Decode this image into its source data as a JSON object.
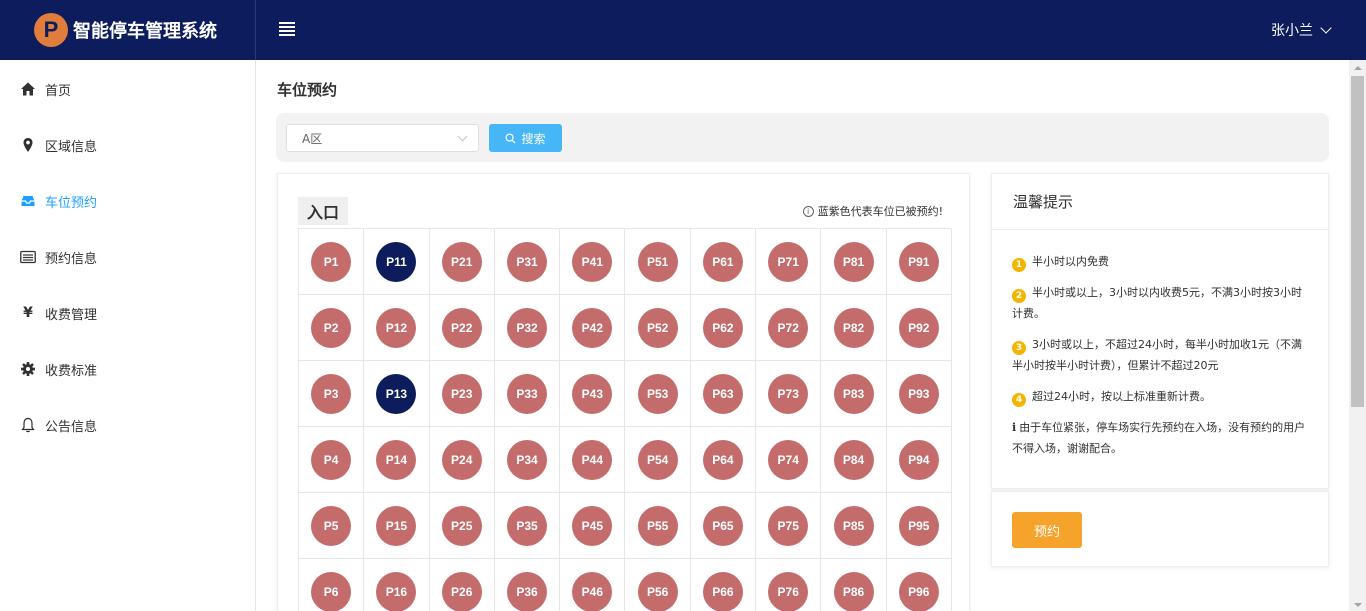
{
  "app": {
    "logo_letter": "P",
    "title": "智能停车管理系统",
    "user_name": "张小兰"
  },
  "sidebar": {
    "items": [
      {
        "label": "首页",
        "icon": "home-icon",
        "active": false
      },
      {
        "label": "区域信息",
        "icon": "location-pin-icon",
        "active": false
      },
      {
        "label": "车位预约",
        "icon": "inbox-icon",
        "active": true
      },
      {
        "label": "预约信息",
        "icon": "list-card-icon",
        "active": false
      },
      {
        "label": "收费管理",
        "icon": "yen-icon",
        "active": false
      },
      {
        "label": "收费标准",
        "icon": "gear-icon",
        "active": false
      },
      {
        "label": "公告信息",
        "icon": "bell-icon",
        "active": false
      }
    ]
  },
  "main": {
    "page_title": "车位预约",
    "search": {
      "area_value": "A区",
      "button_label": "搜索"
    },
    "lot": {
      "entrance_label": "入口",
      "notice": "蓝紫色代表车位已被预约!",
      "spots": [
        [
          "P1",
          "P11",
          "P21",
          "P31",
          "P41",
          "P51",
          "P61",
          "P71",
          "P81",
          "P91"
        ],
        [
          "P2",
          "P12",
          "P22",
          "P32",
          "P42",
          "P52",
          "P62",
          "P72",
          "P82",
          "P92"
        ],
        [
          "P3",
          "P13",
          "P23",
          "P33",
          "P43",
          "P53",
          "P63",
          "P73",
          "P83",
          "P93"
        ],
        [
          "P4",
          "P14",
          "P24",
          "P34",
          "P44",
          "P54",
          "P64",
          "P74",
          "P84",
          "P94"
        ],
        [
          "P5",
          "P15",
          "P25",
          "P35",
          "P45",
          "P55",
          "P65",
          "P75",
          "P85",
          "P95"
        ],
        [
          "P6",
          "P16",
          "P26",
          "P36",
          "P46",
          "P56",
          "P66",
          "P76",
          "P86",
          "P96"
        ]
      ],
      "booked": [
        "P11",
        "P13"
      ]
    },
    "tips": {
      "title": "温馨提示",
      "items": [
        {
          "num": "1",
          "text": "半小时以内免费"
        },
        {
          "num": "2",
          "text": "半小时或以上，3小时以内收费5元，不满3小时按3小时计费。"
        },
        {
          "num": "3",
          "text": "3小时或以上，不超过24小时，每半小时加收1元（不满半小时按半小时计费），但累计不超过20元"
        },
        {
          "num": "4",
          "text": "超过24小时，按以上标准重新计费。"
        }
      ],
      "note": "由于车位紧张，停车场实行先预约在入场，没有预约的用户不得入场，谢谢配合。"
    },
    "reserve_button": "预约"
  },
  "colors": {
    "header": "#0c1c5c",
    "active": "#1e9fff",
    "spot_free": "#c46c6c",
    "spot_booked": "#0c1c5c",
    "search_btn": "#46b6f6",
    "reserve_btn": "#f5a32a",
    "tip_badge": "#f5b400"
  }
}
